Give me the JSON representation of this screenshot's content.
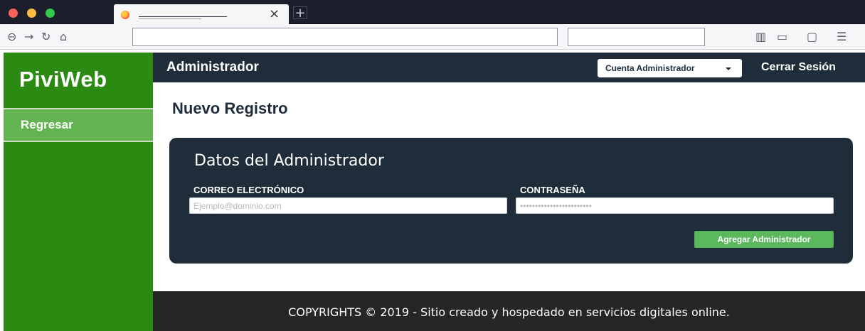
{
  "browser": {
    "tab_close_glyph": "×",
    "new_tab_glyph": "+",
    "icons": [
      "back-icon",
      "forward-icon",
      "reload-icon",
      "home-icon",
      "library-icon",
      "reader-icon",
      "sidebar-icon",
      "menu-icon"
    ],
    "glyphs": {
      "back": "⊖",
      "forward": "→",
      "reload": "↻",
      "home": "⌂",
      "library": "▥",
      "reader": "▭",
      "sidebar": "▢",
      "menu": "☰"
    }
  },
  "sidebar": {
    "brand": "PiviWeb",
    "items": [
      {
        "label": "Regresar"
      }
    ]
  },
  "header": {
    "title": "Administrador",
    "account_button": "Cuenta Administrador",
    "logout": "Cerrar Sesión"
  },
  "main": {
    "page_title": "Nuevo Registro",
    "card": {
      "title": "Datos del Administrador",
      "email_label": "CORREO ELECTRÓNICO",
      "email_placeholder": "Ejemplo@dominio.com",
      "password_label": "CONTRASEÑA",
      "password_placeholder": "••••••••••••••••••••••••",
      "submit": "Agregar Administrador"
    }
  },
  "footer": {
    "text": "COPYRIGHTS © 2019 - Sitio creado y hospedado en servicios digitales online."
  },
  "colors": {
    "sidebar": "#2a8a11",
    "sidebar_active": "#63b352",
    "header": "#1f2d3a",
    "card": "#1f2d3a",
    "button_success": "#5cb85c",
    "footer": "#262626"
  }
}
